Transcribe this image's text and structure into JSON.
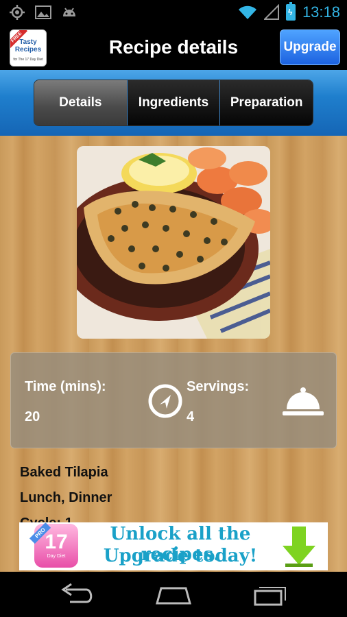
{
  "status_bar": {
    "time": "13:18",
    "icons": [
      "gps-icon",
      "image-icon",
      "android-icon",
      "wifi-icon",
      "signal-icon",
      "battery-charging-icon"
    ]
  },
  "header": {
    "title": "Recipe details",
    "upgrade_label": "Upgrade",
    "logo": {
      "badge": "FREE",
      "line1": "Tasty",
      "line2": "Recipes",
      "line3": "for The 17 Day Diet"
    }
  },
  "tabs": [
    {
      "label": "Details",
      "active": true
    },
    {
      "label": "Ingredients",
      "active": false
    },
    {
      "label": "Preparation",
      "active": false
    }
  ],
  "recipe": {
    "time_label": "Time (mins):",
    "time_value": "20",
    "servings_label": "Servings:",
    "servings_value": "4",
    "name": "Baked Tilapia",
    "meals": "Lunch, Dinner",
    "cycle_partial": "Cycle: 1"
  },
  "ad": {
    "badge": "PRO",
    "logo_number": "17",
    "logo_sub": "Day Diet",
    "line1": "Unlock all the recipes.",
    "line2": "Upgrade today!"
  },
  "colors": {
    "accent_blue": "#33b5e5",
    "tab_bar_blue": "#1f7fcd",
    "upgrade_button": "#1c62e0",
    "ad_text": "#1aa1c8",
    "ad_arrow": "#7ed321"
  }
}
